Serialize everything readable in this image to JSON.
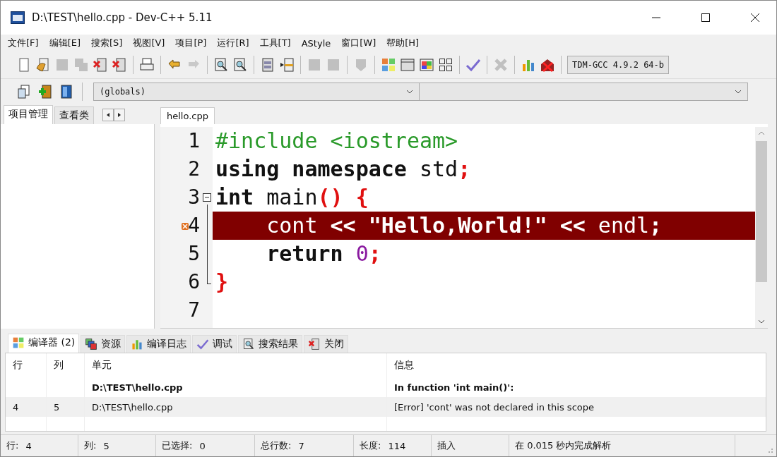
{
  "window": {
    "title": "D:\\TEST\\hello.cpp - Dev-C++ 5.11"
  },
  "menu": [
    "文件[F]",
    "编辑[E]",
    "搜索[S]",
    "视图[V]",
    "项目[P]",
    "运行[R]",
    "工具[T]",
    "AStyle",
    "窗口[W]",
    "帮助[H]"
  ],
  "toolbar": [
    {
      "kind": "page",
      "disabled": false
    },
    {
      "kind": "open",
      "disabled": false
    },
    {
      "kind": "save",
      "disabled": true
    },
    {
      "kind": "saveall",
      "disabled": true
    },
    {
      "kind": "closefile",
      "disabled": false
    },
    {
      "kind": "closeall",
      "disabled": false
    },
    {
      "kind": "sep"
    },
    {
      "kind": "print",
      "disabled": false
    },
    {
      "kind": "sep"
    },
    {
      "kind": "undo",
      "disabled": false
    },
    {
      "kind": "redo",
      "disabled": true
    },
    {
      "kind": "sep"
    },
    {
      "kind": "find",
      "disabled": false
    },
    {
      "kind": "replace",
      "disabled": false
    },
    {
      "kind": "sep"
    },
    {
      "kind": "list",
      "disabled": false
    },
    {
      "kind": "goto",
      "disabled": false
    },
    {
      "kind": "sep"
    },
    {
      "kind": "prev",
      "disabled": true
    },
    {
      "kind": "next",
      "disabled": true
    },
    {
      "kind": "sep"
    },
    {
      "kind": "bookmark",
      "disabled": true
    },
    {
      "kind": "sep"
    },
    {
      "kind": "grid",
      "disabled": false
    },
    {
      "kind": "window",
      "disabled": false
    },
    {
      "kind": "colorgrid",
      "disabled": false
    },
    {
      "kind": "squares",
      "disabled": false
    },
    {
      "kind": "sep"
    },
    {
      "kind": "check",
      "disabled": false
    },
    {
      "kind": "sep"
    },
    {
      "kind": "cross",
      "disabled": true
    },
    {
      "kind": "sep"
    },
    {
      "kind": "chart",
      "disabled": false
    },
    {
      "kind": "stop",
      "disabled": false
    }
  ],
  "compiler": "TDM-GCC 4.9.2 64-b",
  "toolbar2": [
    {
      "kind": "newproj",
      "disabled": false
    },
    {
      "kind": "addfile",
      "disabled": false
    },
    {
      "kind": "book",
      "disabled": false
    }
  ],
  "combos": [
    {
      "value": "(globals)"
    }
  ],
  "left_tabs": [
    {
      "label": "项目管理",
      "selected": true
    },
    {
      "label": "查看类",
      "selected": false
    }
  ],
  "editor_tabs": [
    {
      "label": "hello.cpp",
      "selected": true
    }
  ],
  "code": [
    {
      "number": "1",
      "error": false,
      "tokens": [
        {
          "kind": "preproc",
          "text": "#include <iostream>"
        }
      ]
    },
    {
      "number": "2",
      "error": false,
      "tokens": [
        {
          "kind": "keyword",
          "text": "using namespace"
        },
        {
          "kind": "plain",
          "text": " std"
        },
        {
          "kind": "symbol",
          "text": ";"
        }
      ]
    },
    {
      "number": "3",
      "error": false,
      "expanded": true,
      "tokens": [
        {
          "kind": "keyword",
          "text": "int"
        },
        {
          "kind": "plain",
          "text": " main"
        },
        {
          "kind": "symbol",
          "text": "() {"
        }
      ],
      "children": [
        {
          "number": "4",
          "error": true,
          "indented": true,
          "tokens": [
            {
              "kind": "plain",
              "text": "cont "
            },
            {
              "kind": "symbol",
              "text": "<<"
            },
            {
              "kind": "string",
              "text": " \"Hello,World!\" "
            },
            {
              "kind": "symbol",
              "text": "<<"
            },
            {
              "kind": "plain",
              "text": " endl"
            },
            {
              "kind": "symbol",
              "text": ";"
            }
          ]
        },
        {
          "number": "5",
          "error": false,
          "indented": true,
          "tokens": [
            {
              "kind": "keyword",
              "text": "return"
            },
            {
              "kind": "number",
              "text": " 0"
            },
            {
              "kind": "symbol",
              "text": ";"
            }
          ]
        },
        {
          "number": "6",
          "error": false,
          "tokens": [
            {
              "kind": "symbol",
              "text": "}"
            }
          ]
        }
      ]
    },
    {
      "number": "7",
      "error": false
    }
  ],
  "bottom_tabs": [
    {
      "kind": "grid",
      "label": "编译器 (2)",
      "selected": true
    },
    {
      "kind": "resources",
      "label": "资源",
      "selected": false
    },
    {
      "kind": "chart",
      "label": "编译日志",
      "selected": false
    },
    {
      "kind": "check",
      "label": "调试",
      "selected": false
    },
    {
      "kind": "find",
      "label": "搜索结果",
      "selected": false
    },
    {
      "kind": "closefile",
      "label": "关闭",
      "selected": false
    }
  ],
  "messages": {
    "columns": [
      "行",
      "列",
      "单元",
      "信息"
    ],
    "rows": [
      {
        "kind": "header",
        "selected": false,
        "line": "",
        "col": "",
        "unit": "D:\\TEST\\hello.cpp",
        "message": "In function 'int main()':"
      },
      {
        "kind": "error",
        "selected": true,
        "line": "4",
        "col": "5",
        "unit": "D:\\TEST\\hello.cpp",
        "message": "[Error] 'cont' was not declared in this scope"
      }
    ]
  },
  "status_bar": [
    {
      "label": "行:",
      "value": "4"
    },
    {
      "label": "列:",
      "value": "5"
    },
    {
      "label": "已选择:",
      "value": "0"
    },
    {
      "label": "总行数:",
      "value": "7"
    },
    {
      "label": "长度:",
      "value": "114"
    },
    {
      "label": "插入"
    },
    {
      "label": "在 0.015 秒内完成解析"
    }
  ]
}
